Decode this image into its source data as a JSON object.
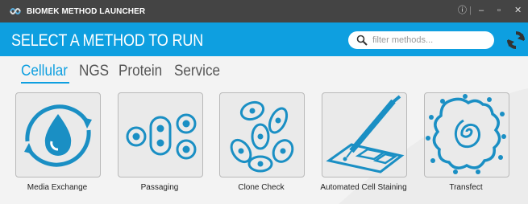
{
  "app": {
    "title": "BIOMEK METHOD LAUNCHER"
  },
  "window_controls": {
    "info": "ⓘ",
    "minimize": "‒",
    "maximize": "▫",
    "close": "✕"
  },
  "header": {
    "title": "SELECT A METHOD TO RUN"
  },
  "search": {
    "placeholder": "filter methods..."
  },
  "tabs": [
    {
      "label": "Cellular",
      "active": true
    },
    {
      "label": "NGS",
      "active": false
    },
    {
      "label": "Protein",
      "active": false
    },
    {
      "label": "Service",
      "active": false
    }
  ],
  "methods": [
    {
      "label": "Media Exchange",
      "icon": "media-exchange-icon"
    },
    {
      "label": "Passaging",
      "icon": "passaging-icon"
    },
    {
      "label": "Clone Check",
      "icon": "clone-check-icon"
    },
    {
      "label": "Automated Cell Staining",
      "icon": "cell-staining-icon"
    },
    {
      "label": "Transfect",
      "icon": "transfect-icon"
    }
  ],
  "colors": {
    "accent": "#0e9fe0",
    "titlebar": "#444444",
    "icon": "#1a8fc4"
  }
}
